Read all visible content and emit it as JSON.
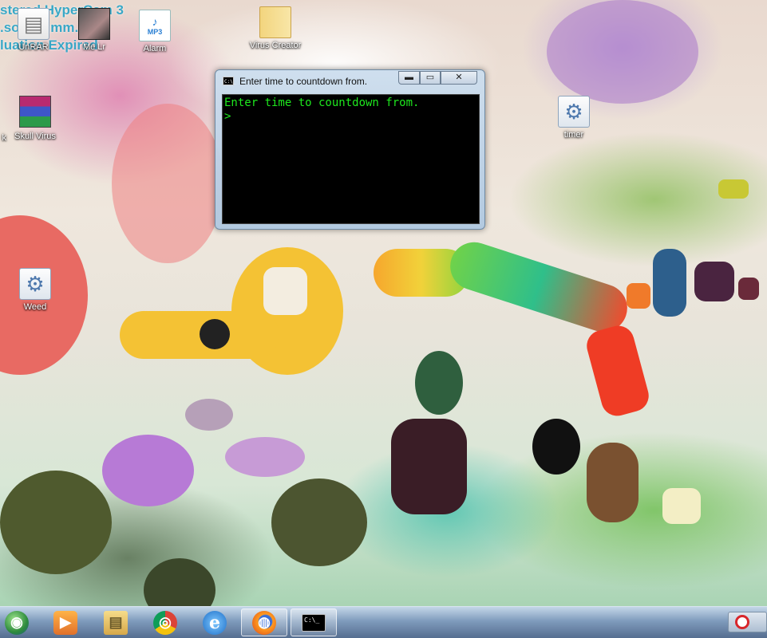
{
  "watermark": {
    "line1": "stered HyperCam 3",
    "line2": ".solveigmm.com",
    "line3": "luation Expired"
  },
  "desktop_icons": [
    {
      "label": "UnRAR",
      "icon": "document-icon"
    },
    {
      "label": "Me Lr",
      "icon": "photo-icon"
    },
    {
      "label": "Alarm",
      "icon": "mp3-file-icon",
      "badge": "MP3"
    },
    {
      "label": "Virus Creator",
      "icon": "folder-icon"
    },
    {
      "label": "k",
      "icon": "partial-icon"
    },
    {
      "label": "Skull Virus",
      "icon": "winrar-icon"
    },
    {
      "label": "timer",
      "icon": "batch-gear-icon"
    },
    {
      "label": "Weed",
      "icon": "batch-gear-icon"
    }
  ],
  "console": {
    "title": "Enter time to countdown from.",
    "icon_text": "C:\\_",
    "line1": "Enter time to countdown from.",
    "line2": ">",
    "text_color": "#1ee81e",
    "minimize": "▬",
    "maximize": "▭",
    "close": "✕"
  },
  "taskbar": {
    "items": [
      {
        "name": "start-orb",
        "icon": "globe-icon",
        "glyph": "◉"
      },
      {
        "name": "media-player",
        "icon": "media-player-icon",
        "glyph": "▶"
      },
      {
        "name": "explorer",
        "icon": "folder-icon",
        "glyph": "▤"
      },
      {
        "name": "chrome",
        "icon": "chrome-icon",
        "glyph": "◎"
      },
      {
        "name": "internet-explorer",
        "icon": "ie-icon",
        "glyph": "e"
      },
      {
        "name": "firefox",
        "icon": "firefox-icon",
        "glyph": "◍"
      },
      {
        "name": "cmd",
        "icon": "cmd-icon",
        "glyph": "C:\\_"
      }
    ],
    "tray_icon": "record-icon"
  }
}
